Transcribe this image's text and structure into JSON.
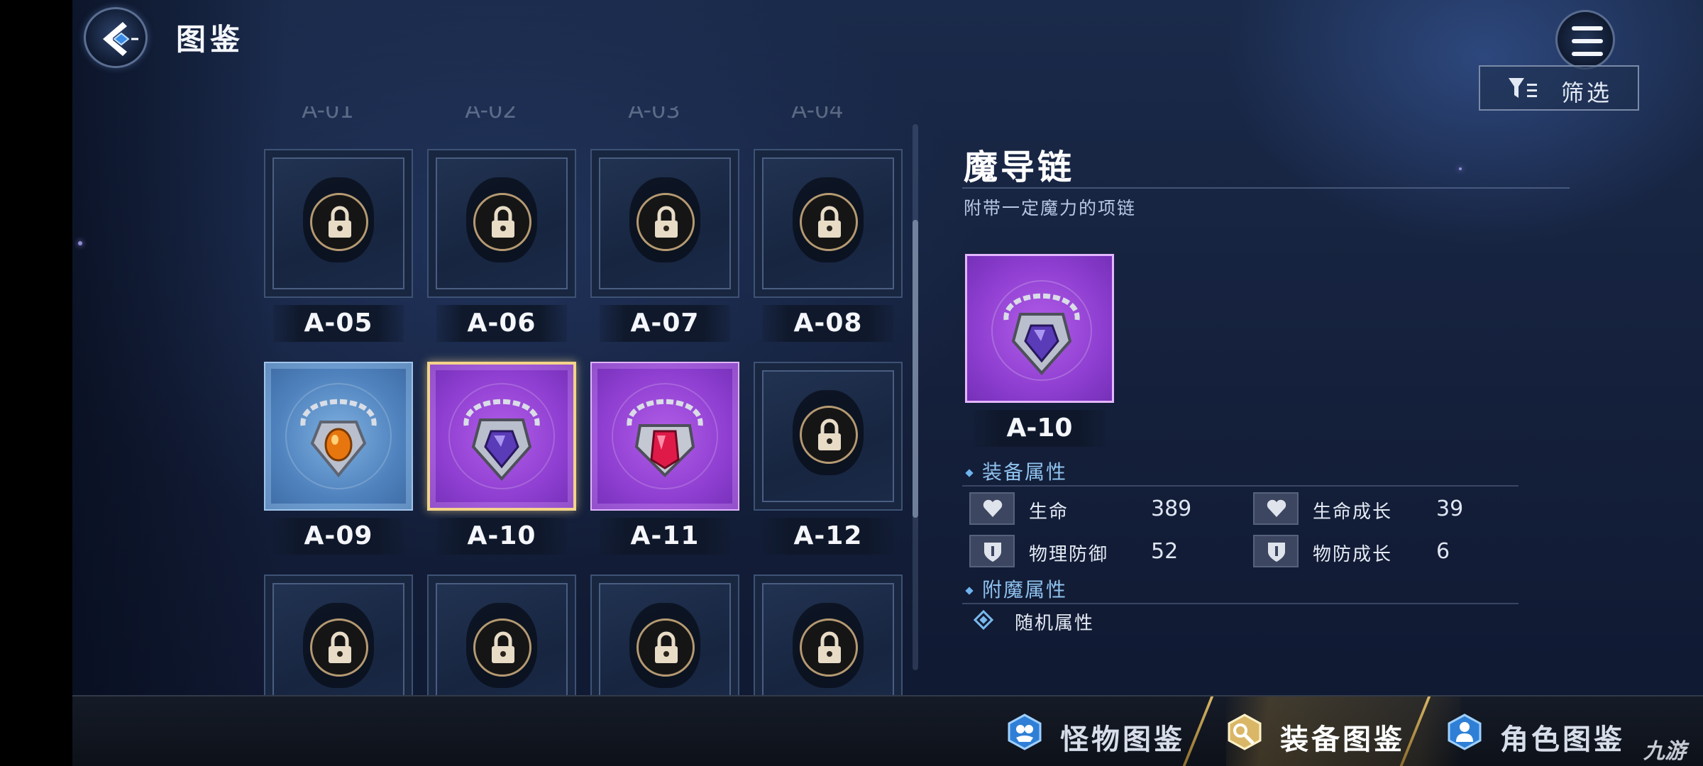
{
  "header": {
    "title": "图鉴",
    "filter_label": "筛选"
  },
  "grid": {
    "ghost_labels": [
      "A-01",
      "A-02",
      "A-03",
      "A-04"
    ],
    "cards": [
      {
        "code": "A-05",
        "state": "locked"
      },
      {
        "code": "A-06",
        "state": "locked"
      },
      {
        "code": "A-07",
        "state": "locked"
      },
      {
        "code": "A-08",
        "state": "locked"
      },
      {
        "code": "A-09",
        "state": "unlocked",
        "rarity": "blue"
      },
      {
        "code": "A-10",
        "state": "unlocked",
        "rarity": "purple",
        "selected": true
      },
      {
        "code": "A-11",
        "state": "unlocked",
        "rarity": "purple"
      },
      {
        "code": "A-12",
        "state": "locked"
      },
      {
        "state": "locked"
      },
      {
        "state": "locked"
      },
      {
        "state": "locked"
      },
      {
        "state": "locked"
      }
    ]
  },
  "detail": {
    "name": "魔导链",
    "description": "附带一定魔力的项链",
    "code": "A-10",
    "equip_attr_heading": "装备属性",
    "stats": [
      {
        "icon": "heart-icon",
        "name": "生命",
        "value": "389"
      },
      {
        "icon": "heart-icon",
        "name": "生命成长",
        "value": "39"
      },
      {
        "icon": "shield-icon",
        "name": "物理防御",
        "value": "52"
      },
      {
        "icon": "shield-icon",
        "name": "物防成长",
        "value": "6"
      }
    ],
    "enchant_heading": "附魔属性",
    "enchant_item": "随机属性"
  },
  "tabs": [
    {
      "label": "怪物图鉴",
      "icon": "monster-icon",
      "active": false
    },
    {
      "label": "装备图鉴",
      "icon": "equipment-icon",
      "active": true
    },
    {
      "label": "角色图鉴",
      "icon": "character-icon",
      "active": false
    }
  ],
  "watermark": "九游",
  "colors": {
    "accent_blue": "#6fb4ef",
    "selected_gold": "#f3d38a",
    "rarity_purple": "#8f3fd1",
    "rarity_blue": "#4f82bd"
  }
}
